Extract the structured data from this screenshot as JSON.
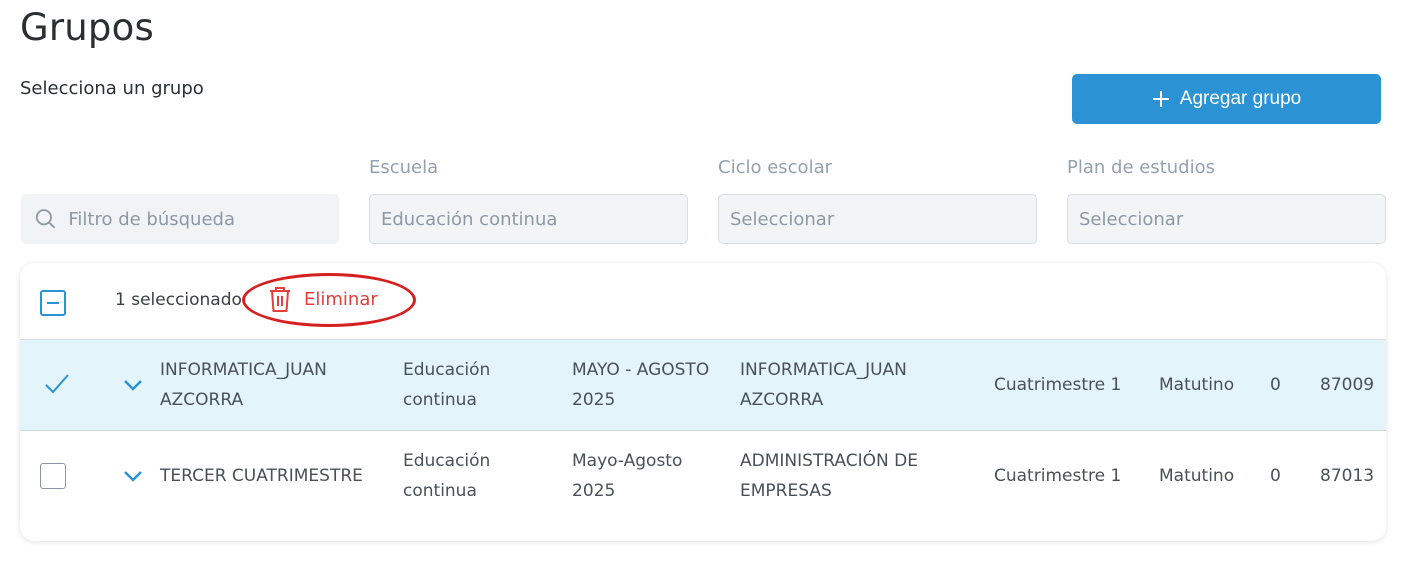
{
  "page": {
    "title": "Grupos",
    "subtitle": "Selecciona un grupo",
    "add_button": "Agregar grupo"
  },
  "filters": {
    "search_placeholder": "Filtro de búsqueda",
    "school_label": "Escuela",
    "school_value": "Educación continua",
    "cycle_label": "Ciclo escolar",
    "cycle_value": "Seleccionar",
    "plan_label": "Plan de estudios",
    "plan_value": "Seleccionar"
  },
  "toolbar": {
    "selected_count": "1 seleccionado",
    "delete_label": "Eliminar"
  },
  "rows": [
    {
      "selected": true,
      "name_line1": "INFORMATICA_JUAN",
      "name_line2": "AZCORRA",
      "school_line1": "Educación",
      "school_line2": "continua",
      "cycle_line1": "MAYO - AGOSTO",
      "cycle_line2": "2025",
      "plan_line1": "INFORMATICA_JUAN",
      "plan_line2": "AZCORRA",
      "period": "Cuatrimestre 1",
      "shift": "Matutino",
      "count": "0",
      "code": "87009"
    },
    {
      "selected": false,
      "name_line1": "TERCER CUATRIMESTRE",
      "school_line1": "Educación",
      "school_line2": "continua",
      "cycle_line1": "Mayo-Agosto",
      "cycle_line2": "2025",
      "plan_line1": "ADMINISTRACIÓN DE",
      "plan_line2": "EMPRESAS",
      "period": "Cuatrimestre 1",
      "shift": "Matutino",
      "count": "0",
      "code": "87013"
    }
  ],
  "colors": {
    "accent": "#2b93d4",
    "danger": "#e2413b",
    "selected_row": "#e4f4fb"
  },
  "icons": [
    "plus-icon",
    "search-icon",
    "trash-icon",
    "check-icon",
    "chevron-down-icon"
  ]
}
